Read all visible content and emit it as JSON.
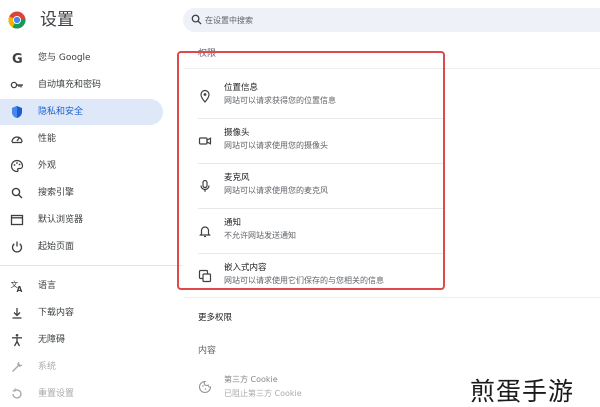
{
  "app": {
    "title": "设置"
  },
  "search": {
    "placeholder": "在设置中搜索"
  },
  "sidebar": {
    "items": [
      {
        "label": "您与 Google",
        "icon": "google-icon",
        "active": false
      },
      {
        "label": "自动填充和密码",
        "icon": "key-icon",
        "active": false
      },
      {
        "label": "隐私和安全",
        "icon": "shield-icon",
        "active": true
      },
      {
        "label": "性能",
        "icon": "speedometer-icon",
        "active": false
      },
      {
        "label": "外观",
        "icon": "palette-icon",
        "active": false
      },
      {
        "label": "搜索引擎",
        "icon": "search-icon",
        "active": false
      },
      {
        "label": "默认浏览器",
        "icon": "browser-window-icon",
        "active": false
      },
      {
        "label": "起始页面",
        "icon": "power-icon",
        "active": false
      },
      {
        "label": "语言",
        "icon": "translate-icon",
        "active": false
      },
      {
        "label": "下载内容",
        "icon": "download-icon",
        "active": false
      },
      {
        "label": "无障碍",
        "icon": "accessibility-icon",
        "active": false
      },
      {
        "label": "系统",
        "icon": "wrench-icon",
        "active": false
      },
      {
        "label": "重置设置",
        "icon": "reset-icon",
        "active": false
      }
    ]
  },
  "main": {
    "permissions_header": "权限",
    "permissions": [
      {
        "title": "位置信息",
        "desc": "网站可以请求获得您的位置信息",
        "icon": "location-pin-icon"
      },
      {
        "title": "摄像头",
        "desc": "网站可以请求使用您的摄像头",
        "icon": "camera-icon"
      },
      {
        "title": "麦克风",
        "desc": "网站可以请求使用您的麦克风",
        "icon": "microphone-icon"
      },
      {
        "title": "通知",
        "desc": "不允许网站发送通知",
        "icon": "bell-icon"
      },
      {
        "title": "嵌入式内容",
        "desc": "网站可以请求使用它们保存的与您相关的信息",
        "icon": "embedded-content-icon"
      }
    ],
    "more_permissions": "更多权限",
    "content_header": "内容",
    "cookie": {
      "title": "第三方 Cookie",
      "desc": "已阻止第三方 Cookie",
      "icon": "cookie-icon"
    }
  },
  "watermark": "煎蛋手游",
  "colors": {
    "accent": "#1a5fd1",
    "active_bg": "#dfe8f8",
    "highlight": "#e0484a",
    "search_bg": "#eef1f7"
  }
}
